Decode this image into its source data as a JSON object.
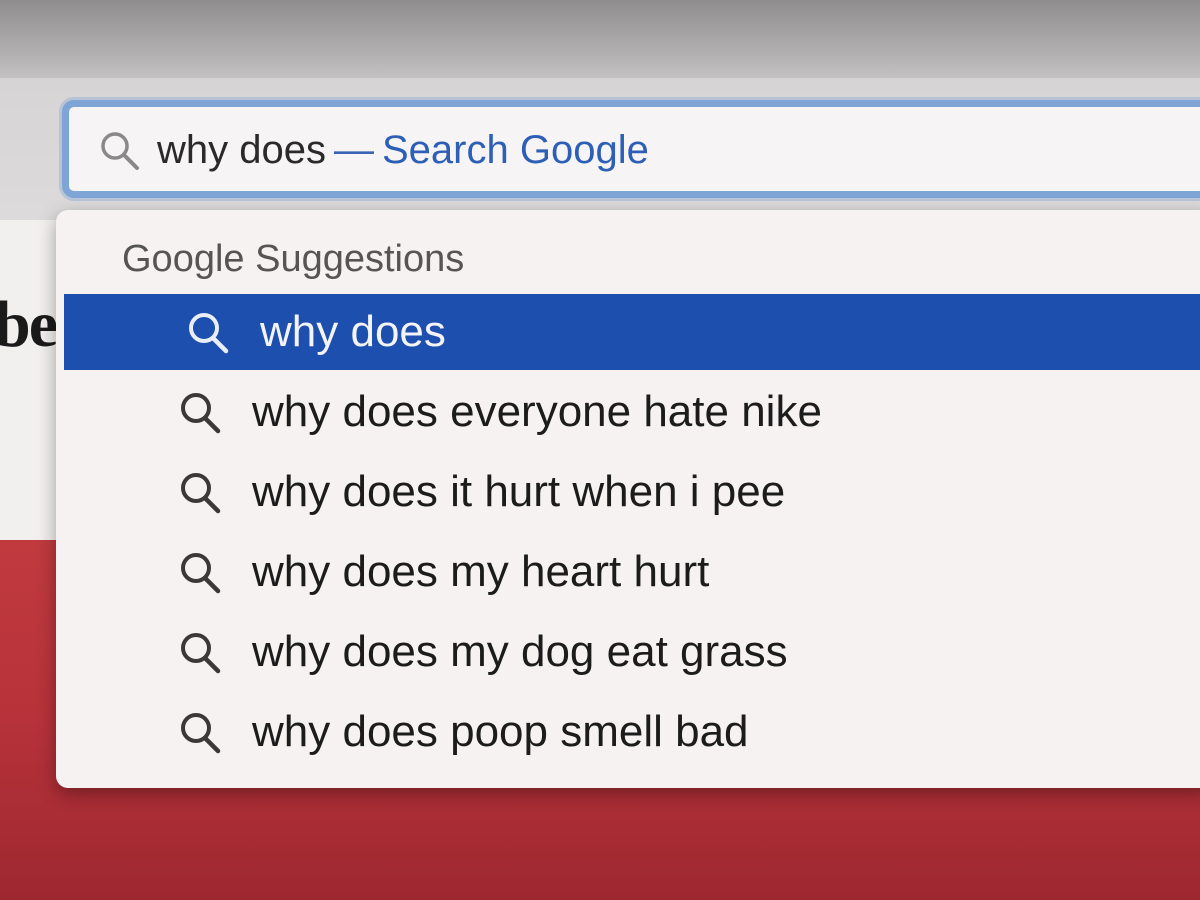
{
  "page": {
    "partial_text": "be"
  },
  "address_bar": {
    "icon": "search-icon",
    "query": "why does",
    "separator": "—",
    "hint": "Search Google"
  },
  "suggestions": {
    "header": "Google Suggestions",
    "items": [
      {
        "label": "why does",
        "icon": "search-icon",
        "selected": true
      },
      {
        "label": "why does everyone hate nike",
        "icon": "search-icon",
        "selected": false
      },
      {
        "label": "why does it hurt when i pee",
        "icon": "search-icon",
        "selected": false
      },
      {
        "label": "why does my heart hurt",
        "icon": "search-icon",
        "selected": false
      },
      {
        "label": "why does my dog eat grass",
        "icon": "search-icon",
        "selected": false
      },
      {
        "label": "why does poop smell bad",
        "icon": "search-icon",
        "selected": false
      }
    ]
  },
  "colors": {
    "selection": "#1d4fae",
    "address_focus_ring": "#7fa5d6",
    "hint_text": "#2d5fb6",
    "page_background": "#c03a3e"
  }
}
